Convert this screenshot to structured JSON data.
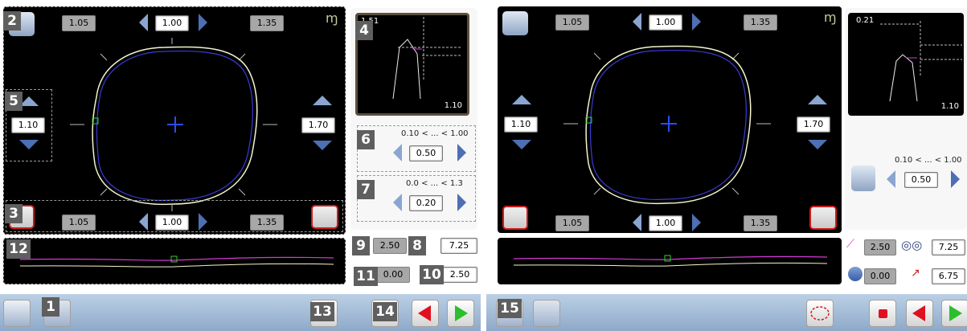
{
  "left": {
    "top_left_val": "1.05",
    "top_center_val": "1.00",
    "top_right_val": "1.35",
    "bottom_left_val": "1.05",
    "bottom_center_val": "1.00",
    "bottom_right_val": "1.35",
    "left_val": "1.10",
    "right_val": "1.70",
    "preview_top": "1.51",
    "preview_bottom": "1.10",
    "range1": "0.10 < ... < 1.00",
    "range1_val": "0.50",
    "range2": "0.0 < ... < 1.3",
    "range2_val": "0.20",
    "b8_val": "7.25",
    "b9_val": "2.50",
    "b10_val": "2.50",
    "b11_val": "0.00",
    "labels": [
      "1",
      "2",
      "3",
      "4",
      "5",
      "6",
      "7",
      "8",
      "9",
      "10",
      "11",
      "12",
      "13",
      "14"
    ]
  },
  "right": {
    "top_left_val": "1.05",
    "top_center_val": "1.00",
    "top_right_val": "1.35",
    "bottom_left_val": "1.05",
    "bottom_center_val": "1.00",
    "bottom_right_val": "1.35",
    "left_val": "1.10",
    "right_val": "1.70",
    "preview_top": "0.21",
    "preview_bottom": "1.10",
    "range1": "0.10 < ... < 1.00",
    "range1_val": "0.50",
    "val_a": "2.50",
    "val_b": "7.25",
    "val_c": "0.00",
    "val_d": "6.75",
    "label15": "15"
  },
  "colors": {
    "accent_blue": "#4d6fb4",
    "bevel_white": "#f5f5cc",
    "groove_magenta": "#d23bd2",
    "stop_red": "#e01020",
    "go_green": "#2bbf2b"
  },
  "icons": [
    "omega-icon",
    "lens-shape-icon",
    "bevel-icon",
    "groove-icon",
    "frame-shape-icon",
    "stop-icon",
    "back-arrow-icon",
    "next-arrow-icon"
  ]
}
